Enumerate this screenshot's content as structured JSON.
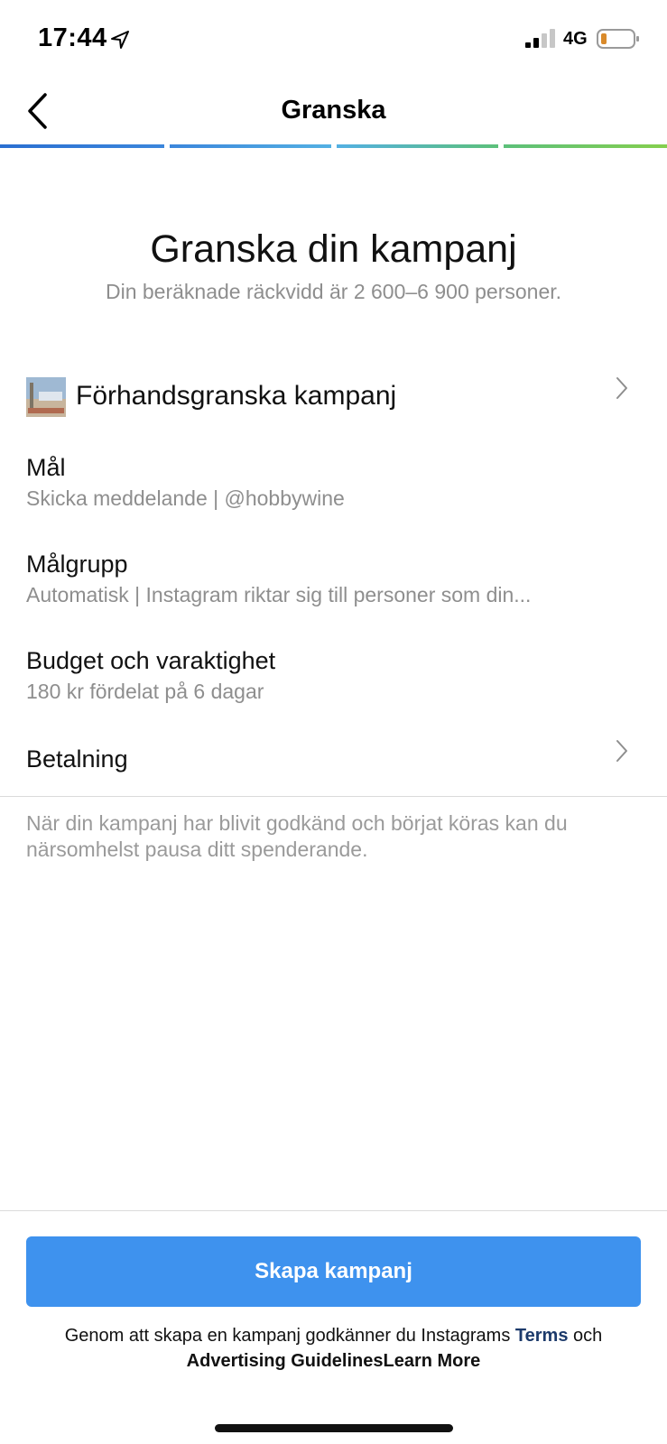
{
  "status_bar": {
    "time": "17:44",
    "network": "4G",
    "icons": [
      "location-arrow-icon",
      "signal-icon",
      "battery-icon"
    ]
  },
  "nav": {
    "title": "Granska",
    "back_icon": "chevron-left-icon",
    "progress_colors": [
      "#2f7fd6",
      "#4fa3e0",
      "#47b9a3",
      "#7ccc57"
    ]
  },
  "header": {
    "title": "Granska din kampanj",
    "subtitle": "Din beräknade räckvidd är 2 600–6 900 personer."
  },
  "rows": {
    "preview": {
      "title": "Förhandsgranska kampanj",
      "icon": "chevron-right-icon"
    },
    "goal": {
      "title": "Mål",
      "value": "Skicka meddelande | @hobbywine"
    },
    "audience": {
      "title": "Målgrupp",
      "value": "Automatisk | Instagram riktar sig till personer som din..."
    },
    "budget": {
      "title": "Budget och varaktighet",
      "value": "180 kr fördelat på 6 dagar"
    },
    "payment": {
      "title": "Betalning",
      "icon": "chevron-right-icon"
    }
  },
  "note": "När din kampanj har blivit godkänd och börjat köras kan du närsomhelst pausa ditt spenderande.",
  "footer": {
    "button_label": "Skapa kampanj",
    "legal_prefix": "Genom att skapa en kampanj godkänner du Instagrams",
    "terms_link": "Terms",
    "legal_and": "och",
    "guidelines_link": "Advertising Guidelines",
    "learn_more_link": "Learn More"
  },
  "colors": {
    "accent": "#3e92ee",
    "secondary_text": "#8e8e8e"
  }
}
